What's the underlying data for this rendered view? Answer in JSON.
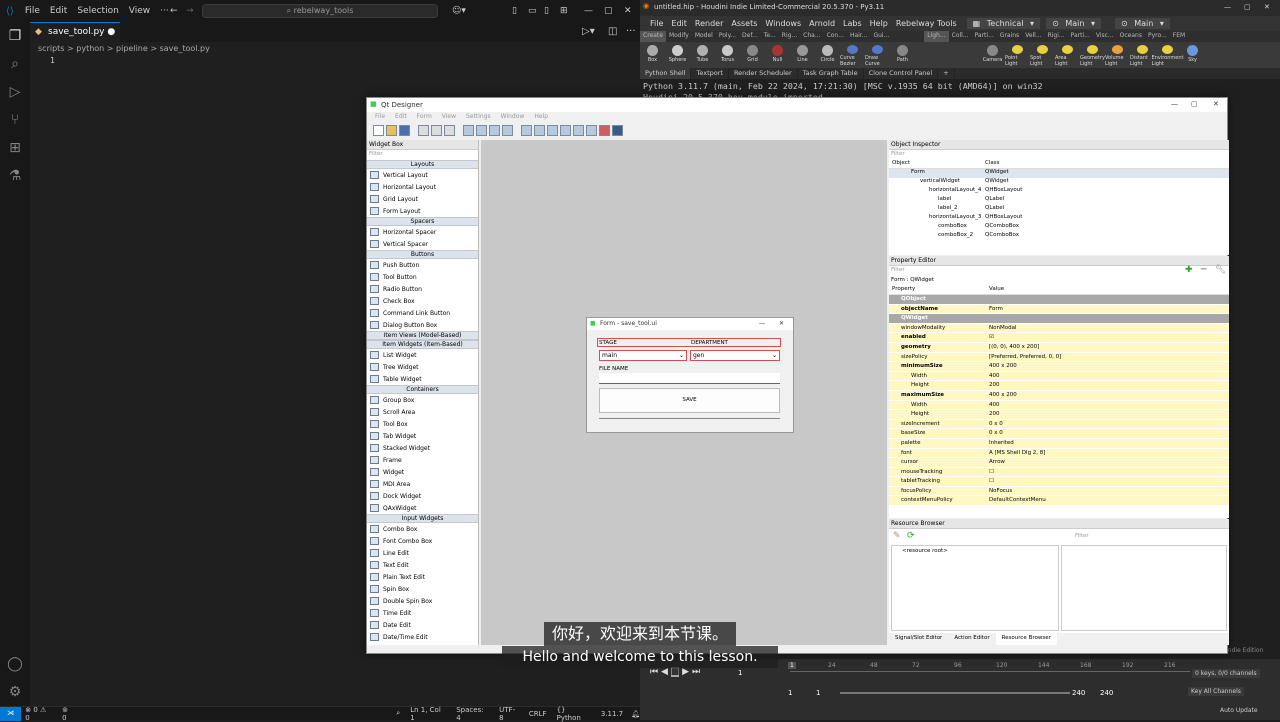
{
  "vscode": {
    "menu": [
      "File",
      "Edit",
      "Selection",
      "View"
    ],
    "search": "rebelway_tools",
    "tab": "save_tool.py",
    "breadcrumb": [
      "scripts",
      "python",
      "pipeline",
      "save_tool.py"
    ],
    "line_number": "1",
    "status": {
      "problems": "⊗ 0 ⚠ 0",
      "ports": "0",
      "position": "Ln 1, Col 1",
      "spaces": "Spaces: 4",
      "encoding": "UTF-8",
      "eol": "CRLF",
      "language": "Python",
      "version": "3.11.7"
    }
  },
  "houdini": {
    "title": "untitled.hip - Houdini Indie Limited-Commercial 20.5.370 - Py3.11",
    "menu": [
      "File",
      "Edit",
      "Render",
      "Assets",
      "Windows",
      "Arnold",
      "Labs",
      "Help",
      "Rebelway Tools"
    ],
    "desktop": "Technical",
    "context1": "Main",
    "context2": "Main",
    "shelf_tabs": [
      "Create",
      "Modify",
      "Model",
      "Poly...",
      "Def...",
      "Te...",
      "Rig...",
      "Cha...",
      "Con...",
      "Hair...",
      "Gui..."
    ],
    "shelf_tools": [
      {
        "label": "Box",
        "color": "#aaaaaa"
      },
      {
        "label": "Sphere",
        "color": "#cccccc"
      },
      {
        "label": "Tube",
        "color": "#b0b0b0"
      },
      {
        "label": "Torus",
        "color": "#c8c8c8"
      },
      {
        "label": "Grid",
        "color": "#888888"
      },
      {
        "label": "Null",
        "color": "#aa3333"
      },
      {
        "label": "Line",
        "color": "#999999"
      },
      {
        "label": "Circle",
        "color": "#bbbbbb"
      },
      {
        "label": "Curve Bezier",
        "color": "#5577cc"
      },
      {
        "label": "Draw Curve",
        "color": "#5577cc"
      },
      {
        "label": "Path",
        "color": "#888888"
      }
    ],
    "light_tabs": [
      "Ligh...",
      "Coll...",
      "Parti...",
      "Grains",
      "Vell...",
      "Rigi...",
      "Parti...",
      "Visc...",
      "Oceans",
      "Pyro...",
      "FEM"
    ],
    "light_tools": [
      {
        "label": "Camera",
        "color": "#888888"
      },
      {
        "label": "Point Light",
        "color": "#e8d040"
      },
      {
        "label": "Spot Light",
        "color": "#e8d040"
      },
      {
        "label": "Area Light",
        "color": "#e8d040"
      },
      {
        "label": "Geometry Light",
        "color": "#e8d040"
      },
      {
        "label": "Volume Light",
        "color": "#e8a040"
      },
      {
        "label": "Distant Light",
        "color": "#e8d040"
      },
      {
        "label": "Environment Light",
        "color": "#e8d040"
      },
      {
        "label": "Sky",
        "color": "#6699dd"
      }
    ],
    "pane_tabs": [
      "Python Shell",
      "Textport",
      "Render Scheduler",
      "Task Graph Table",
      "Clone Control Panel"
    ],
    "shell_lines": [
      "Python 3.11.7 (main, Feb 22 2024, 17:21:30) [MSC v.1935 64 bit (AMD64)] on win32",
      "Houdini 20.5.370 hou module imported."
    ],
    "timeline": {
      "frame": "1",
      "start": "1",
      "start2": "1",
      "end": "240",
      "end2": "240",
      "keys": "0 keys, 0/0 channels",
      "key_all": "Key All Channels",
      "auto_update": "Auto Update",
      "edition": "Indie Edition",
      "ticks": [
        "1",
        "24",
        "48",
        "72",
        "96",
        "120",
        "144",
        "168",
        "192",
        "216"
      ]
    }
  },
  "qtdesigner": {
    "title": "Qt Designer",
    "menu": [
      "File",
      "Edit",
      "Form",
      "View",
      "Settings",
      "Window",
      "Help"
    ],
    "widget_box": {
      "title": "Widget Box",
      "filter": "Filter",
      "sections": [
        {
          "name": "Layouts",
          "items": [
            "Vertical Layout",
            "Horizontal Layout",
            "Grid Layout",
            "Form Layout"
          ]
        },
        {
          "name": "Spacers",
          "items": [
            "Horizontal Spacer",
            "Vertical Spacer"
          ]
        },
        {
          "name": "Buttons",
          "items": [
            "Push Button",
            "Tool Button",
            "Radio Button",
            "Check Box",
            "Command Link Button",
            "Dialog Button Box"
          ]
        },
        {
          "name": "Item Views (Model-Based)",
          "items": []
        },
        {
          "name": "Item Widgets (Item-Based)",
          "items": [
            "List Widget",
            "Tree Widget",
            "Table Widget"
          ]
        },
        {
          "name": "Containers",
          "items": [
            "Group Box",
            "Scroll Area",
            "Tool Box",
            "Tab Widget",
            "Stacked Widget",
            "Frame",
            "Widget",
            "MDI Area",
            "Dock Widget",
            "QAxWidget"
          ]
        },
        {
          "name": "Input Widgets",
          "items": [
            "Combo Box",
            "Font Combo Box",
            "Line Edit",
            "Text Edit",
            "Plain Text Edit",
            "Spin Box",
            "Double Spin Box",
            "Time Edit",
            "Date Edit",
            "Date/Time Edit"
          ]
        }
      ]
    },
    "form": {
      "title": "Form - save_tool.ui",
      "stage_label": "STAGE",
      "department_label": "DEPARTMENT",
      "stage_value": "main",
      "department_value": "gen",
      "filename_label": "FILE NAME",
      "save_label": "SAVE"
    },
    "object_inspector": {
      "title": "Object Inspector",
      "filter": "Filter",
      "col_object": "Object",
      "col_class": "Class",
      "rows": [
        {
          "object": "Form",
          "class": "QWidget",
          "indent": 0
        },
        {
          "object": "verticalWidget",
          "class": "QWidget",
          "indent": 1
        },
        {
          "object": "horizontalLayout_4",
          "class": "QHBoxLayout",
          "indent": 2
        },
        {
          "object": "label",
          "class": "QLabel",
          "indent": 3
        },
        {
          "object": "label_2",
          "class": "QLabel",
          "indent": 3
        },
        {
          "object": "horizontalLayout_3",
          "class": "QHBoxLayout",
          "indent": 2
        },
        {
          "object": "comboBox",
          "class": "QComboBox",
          "indent": 3
        },
        {
          "object": "comboBox_2",
          "class": "QComboBox",
          "indent": 3
        }
      ]
    },
    "property_editor": {
      "title": "Property Editor",
      "filter": "Filter",
      "form_label": "Form : QWidget",
      "col_property": "Property",
      "col_value": "Value",
      "rows": [
        {
          "name": "QObject",
          "value": "",
          "type": "grp"
        },
        {
          "name": "objectName",
          "value": "Form",
          "type": "b"
        },
        {
          "name": "QWidget",
          "value": "",
          "type": "grp"
        },
        {
          "name": "windowModality",
          "value": "NonModal",
          "type": ""
        },
        {
          "name": "enabled",
          "value": "☑",
          "type": "b"
        },
        {
          "name": "geometry",
          "value": "[(0, 0), 400 x 200]",
          "type": "b"
        },
        {
          "name": "sizePolicy",
          "value": "[Preferred, Preferred, 0, 0]",
          "type": ""
        },
        {
          "name": "minimumSize",
          "value": "400 x 200",
          "type": "b"
        },
        {
          "name": "Width",
          "value": "400",
          "type": "sub"
        },
        {
          "name": "Height",
          "value": "200",
          "type": "sub"
        },
        {
          "name": "maximumSize",
          "value": "400 x 200",
          "type": "b"
        },
        {
          "name": "Width",
          "value": "400",
          "type": "sub"
        },
        {
          "name": "Height",
          "value": "200",
          "type": "sub"
        },
        {
          "name": "sizeIncrement",
          "value": "0 x 0",
          "type": ""
        },
        {
          "name": "baseSize",
          "value": "0 x 0",
          "type": ""
        },
        {
          "name": "palette",
          "value": "Inherited",
          "type": ""
        },
        {
          "name": "font",
          "value": "A  [MS Shell Dlg 2, 8]",
          "type": ""
        },
        {
          "name": "cursor",
          "value": "Arrow",
          "type": ""
        },
        {
          "name": "mouseTracking",
          "value": "☐",
          "type": ""
        },
        {
          "name": "tabletTracking",
          "value": "☐",
          "type": ""
        },
        {
          "name": "focusPolicy",
          "value": "NoFocus",
          "type": ""
        },
        {
          "name": "contextMenuPolicy",
          "value": "DefaultContextMenu",
          "type": ""
        }
      ]
    },
    "resource_browser": {
      "title": "Resource Browser",
      "filter": "Filter",
      "root": "<resource root>",
      "tabs": [
        "Signal/Slot Editor",
        "Action Editor",
        "Resource Browser"
      ]
    }
  },
  "subtitle": {
    "cn": "你好，欢迎来到本节课。",
    "en": "Hello and welcome to this lesson."
  }
}
